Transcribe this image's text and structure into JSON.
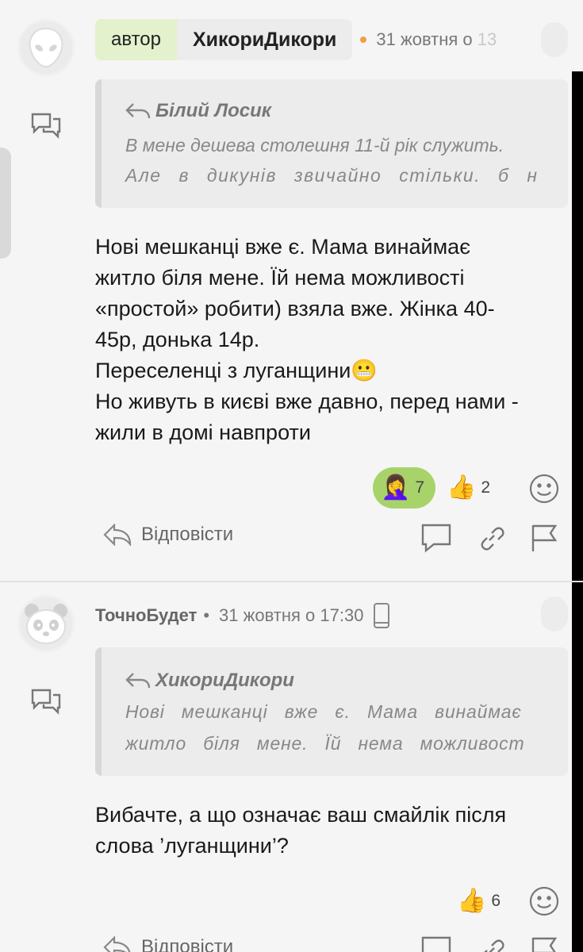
{
  "comment1": {
    "author_tag": "автор",
    "author": "ХикориДикори",
    "date": "31 жовтня о 13",
    "quote": {
      "author": "Білий Лосик",
      "line1": "В мене дешева столешня 11-й рік служить.",
      "line2": "Але в дикунів звичайно стільки. б н"
    },
    "body": [
      "Нові мешканці вже є. Мама винаймає",
      "житло біля мене. Їй нема можливості",
      "«простой» робити) взяла вже. Жінка 40-",
      "45р, донька 14р.",
      "Переселенці з луганщини😬",
      "Но живуть в києві вже давно, перед нами -",
      "жили в домі навпроти"
    ],
    "reactions": [
      {
        "emoji": "🤦‍♀️",
        "count": "7",
        "active": true
      },
      {
        "emoji": "👍",
        "count": "2",
        "active": false
      }
    ],
    "reply_label": "Відповісти"
  },
  "comment2": {
    "author": "ТочноБудет",
    "date": "31 жовтня о 17:30",
    "quote": {
      "author": "ХикориДикори",
      "line1": "Нові мешканці вже є. Мама винаймає",
      "line2": "житло біля мене. Їй нема можливост"
    },
    "body": [
      "Вибачте, а що означає ваш смайлік після",
      "слова ’луганщини’?"
    ],
    "reactions": [
      {
        "emoji": "👍",
        "count": "6",
        "active": false
      }
    ],
    "reply_label": "Відповісти"
  },
  "colors": {
    "author_tag_bg": "#e3f1cd",
    "active_reaction": "#a8d36a",
    "date_dot": "#f0a040"
  }
}
